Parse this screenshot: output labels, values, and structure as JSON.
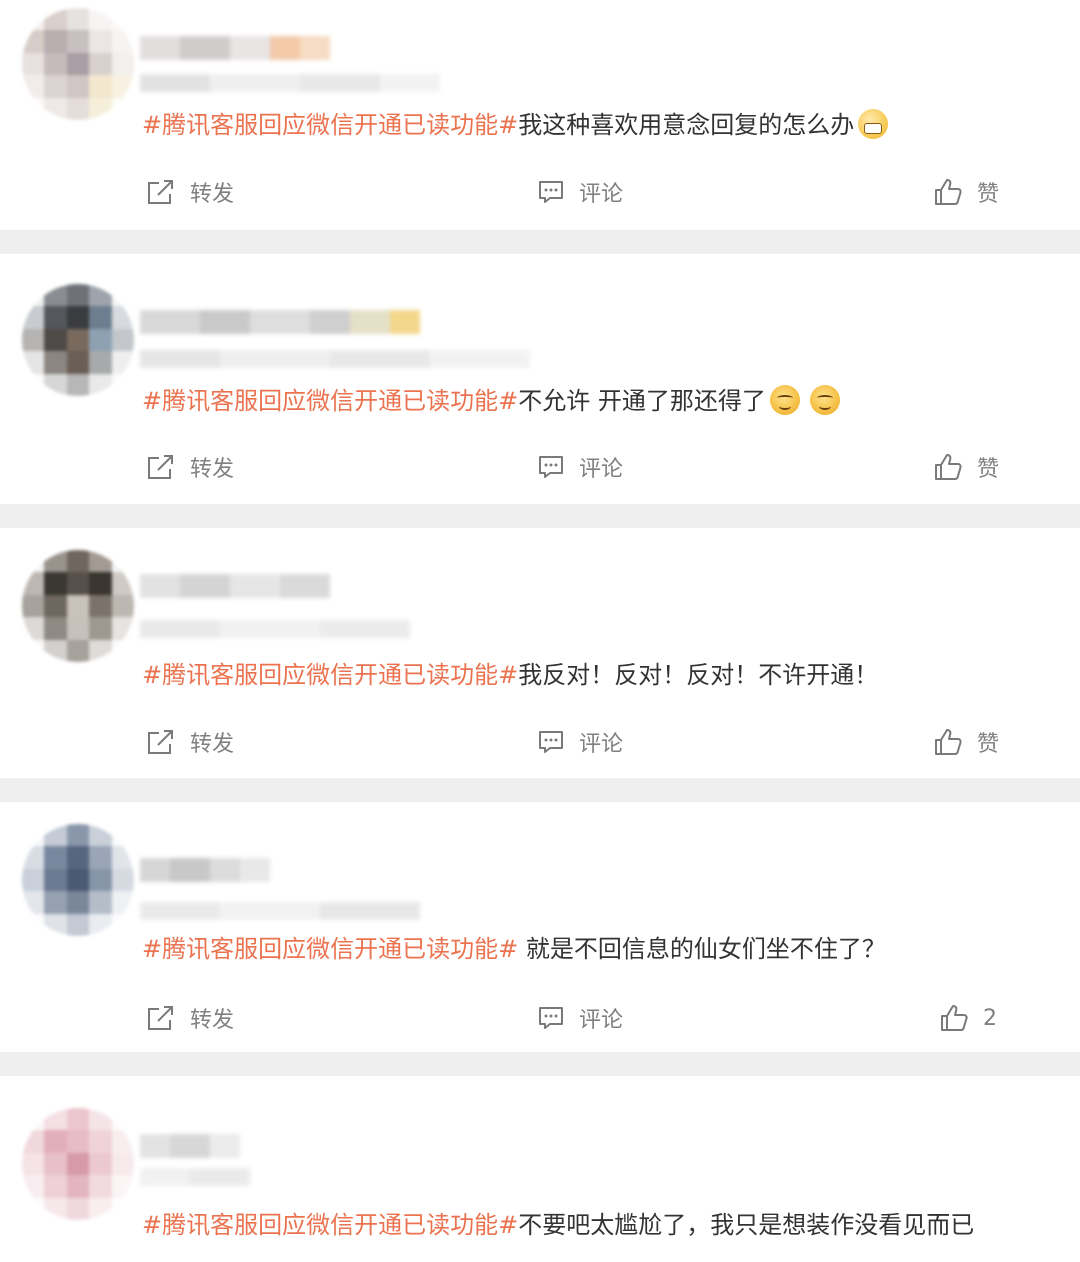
{
  "actions": {
    "repost_label": "转发",
    "comment_label": "评论",
    "like_label": "赞"
  },
  "icons": {
    "repost": "repost-icon",
    "comment": "comment-icon",
    "like": "thumbs-up-icon"
  },
  "colors": {
    "topic": "#eb7350",
    "text": "#333333",
    "action_gray": "#808080",
    "divider": "#efefef"
  },
  "posts": [
    {
      "topic": "#腾讯客服回应微信开通已读功能#",
      "text": "我这种喜欢用意念回复的怎么办",
      "emojis": [
        "grin"
      ],
      "like_label": "赞"
    },
    {
      "topic": "#腾讯客服回应微信开通已读功能#",
      "text": "不允许 开通了那还得了",
      "emojis": [
        "smug",
        "smug"
      ],
      "like_label": "赞"
    },
    {
      "topic": "#腾讯客服回应微信开通已读功能#",
      "text": "我反对！反对！反对！不许开通！",
      "emojis": [],
      "like_label": "赞"
    },
    {
      "topic": "#腾讯客服回应微信开通已读功能#",
      "text": " 就是不回信息的仙女们坐不住了？",
      "emojis": [],
      "like_label": "2"
    },
    {
      "topic": "#腾讯客服回应微信开通已读功能#",
      "text": "不要吧太尴尬了，我只是想装作没看见而已",
      "emojis": [],
      "like_label": ""
    }
  ]
}
